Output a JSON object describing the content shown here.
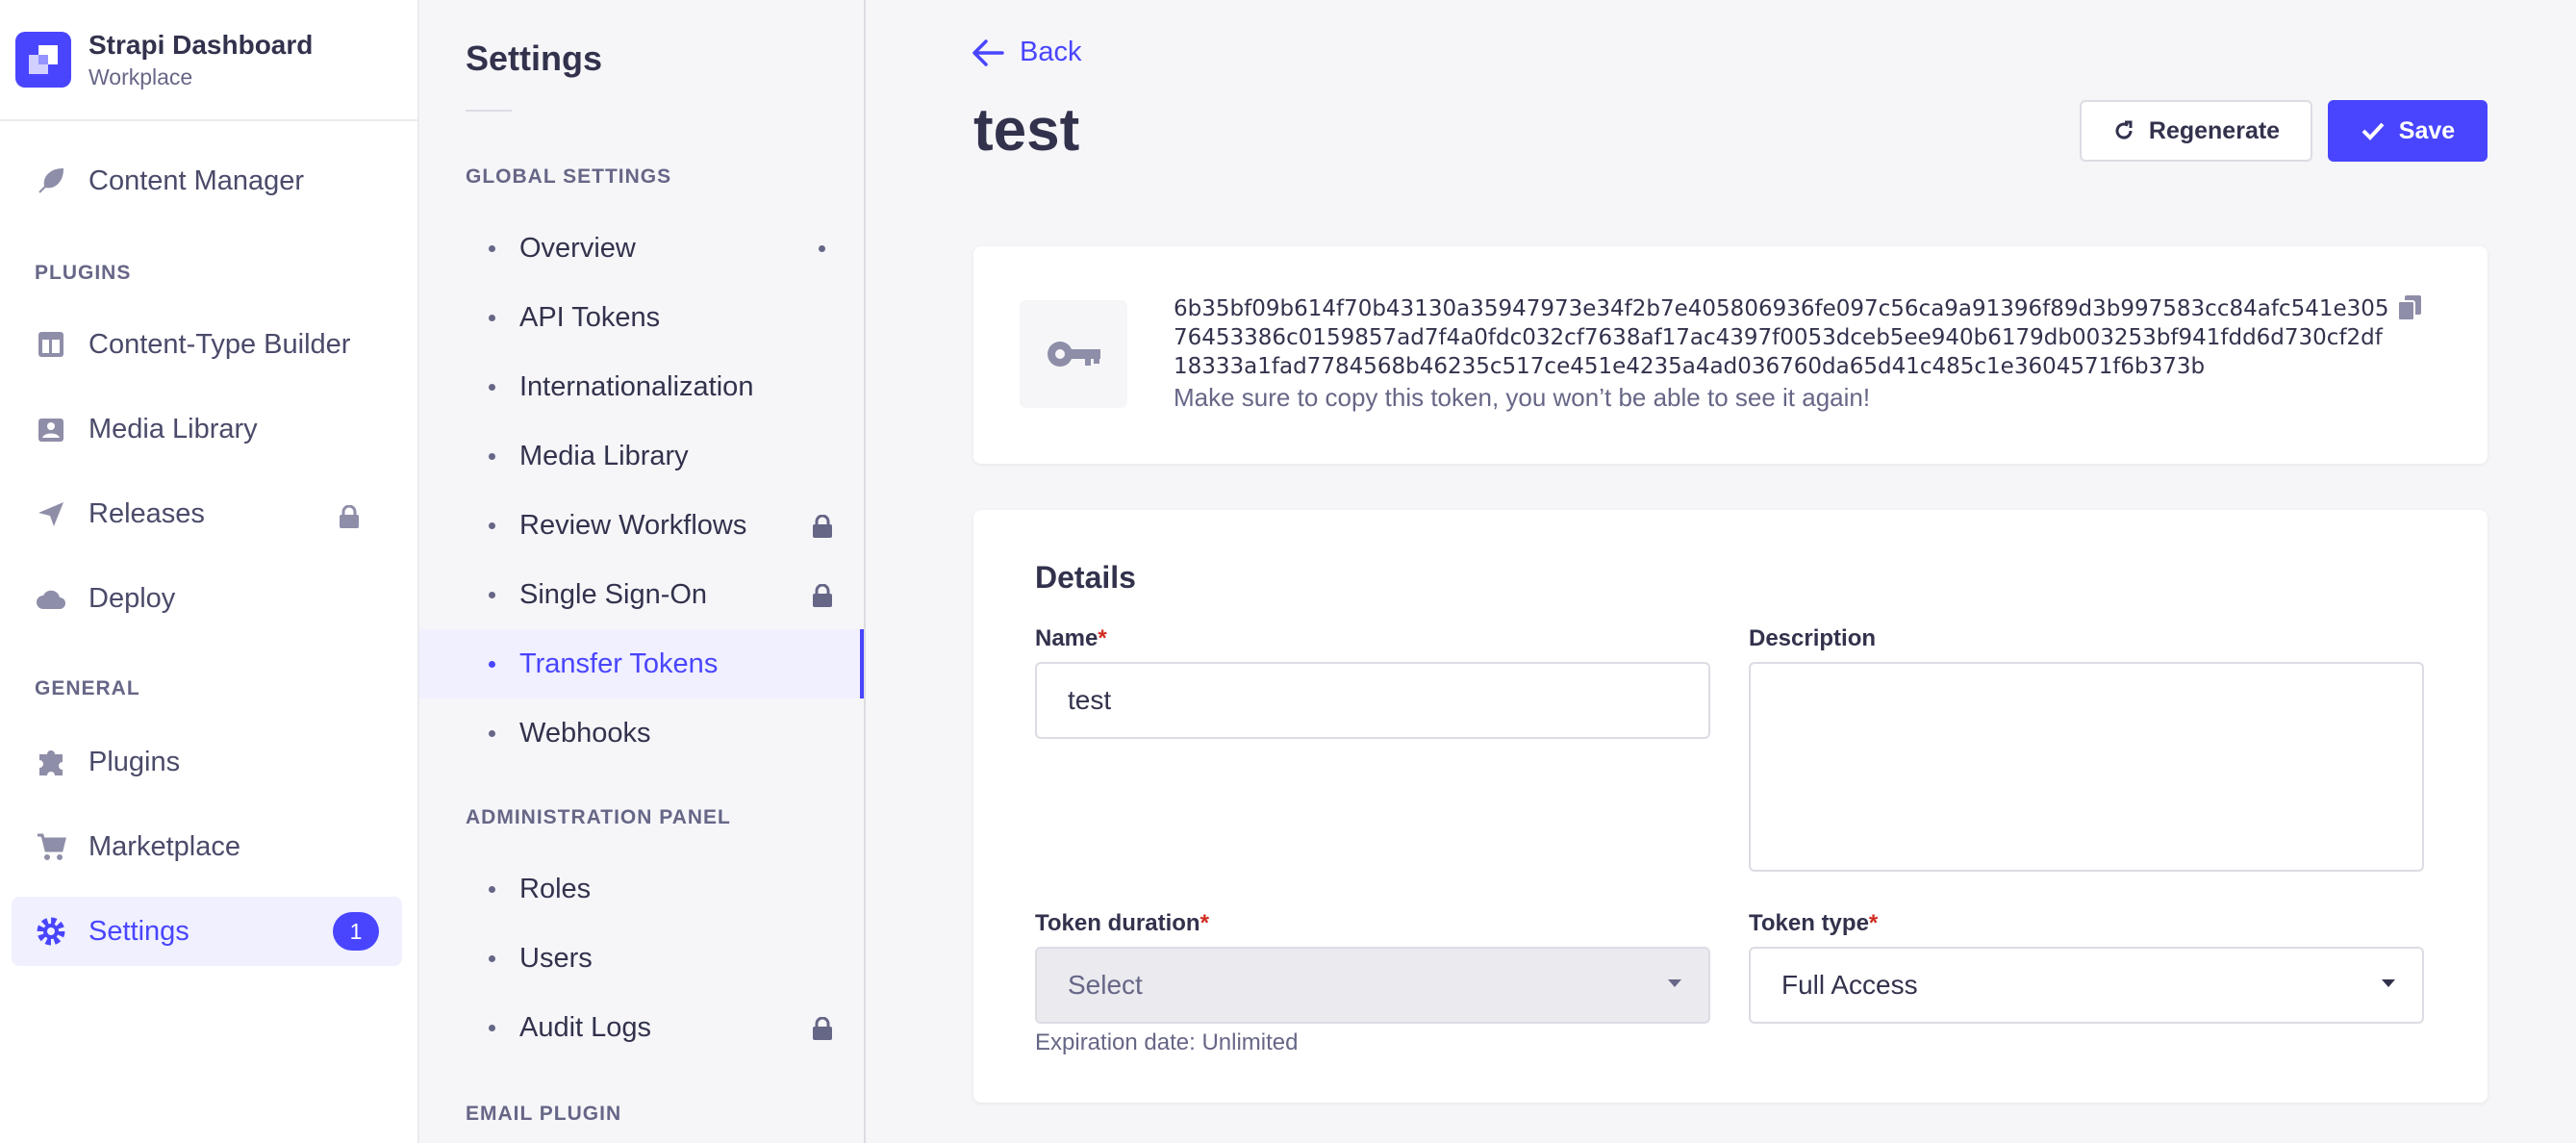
{
  "brand": {
    "title": "Strapi Dashboard",
    "subtitle": "Workplace"
  },
  "leftnav": {
    "content_manager": "Content Manager",
    "plugins_section": "PLUGINS",
    "plugins": [
      "Content-Type Builder",
      "Media Library",
      "Releases",
      "Deploy"
    ],
    "general_section": "GENERAL",
    "general": [
      "Plugins",
      "Marketplace",
      "Settings"
    ],
    "settings_badge": "1"
  },
  "subnav": {
    "title": "Settings",
    "global_section": "GLOBAL SETTINGS",
    "global_items": [
      "Overview",
      "API Tokens",
      "Internationalization",
      "Media Library",
      "Review Workflows",
      "Single Sign-On",
      "Transfer Tokens",
      "Webhooks"
    ],
    "admin_section": "ADMINISTRATION PANEL",
    "admin_items": [
      "Roles",
      "Users",
      "Audit Logs"
    ],
    "email_section": "EMAIL PLUGIN"
  },
  "main": {
    "back_label": "Back",
    "title": "test",
    "regenerate_label": "Regenerate",
    "save_label": "Save",
    "token_value": "6b35bf09b614f70b43130a35947973e34f2b7e405806936fe097c56ca9a91396f89d3b997583cc84afc541e30576453386c0159857ad7f4a0fdc032cf7638af17ac4397f0053dceb5ee940b6179db003253bf941fdd6d730cf2df18333a1fad7784568b46235c517ce451e4235a4ad036760da65d41c485c1e3604571f6b373b",
    "token_hint": "Make sure to copy this token, you won’t be able to see it again!",
    "details_title": "Details",
    "name_label": "Name",
    "name_value": "test",
    "description_label": "Description",
    "description_value": "",
    "duration_label": "Token duration",
    "duration_placeholder": "Select",
    "expiration_hint": "Expiration date: Unlimited",
    "type_label": "Token type",
    "type_value": "Full Access",
    "required_mark": "*"
  },
  "colors": {
    "accent": "#4945ff",
    "required": "#d02b20",
    "background": "#f6f6f9"
  }
}
